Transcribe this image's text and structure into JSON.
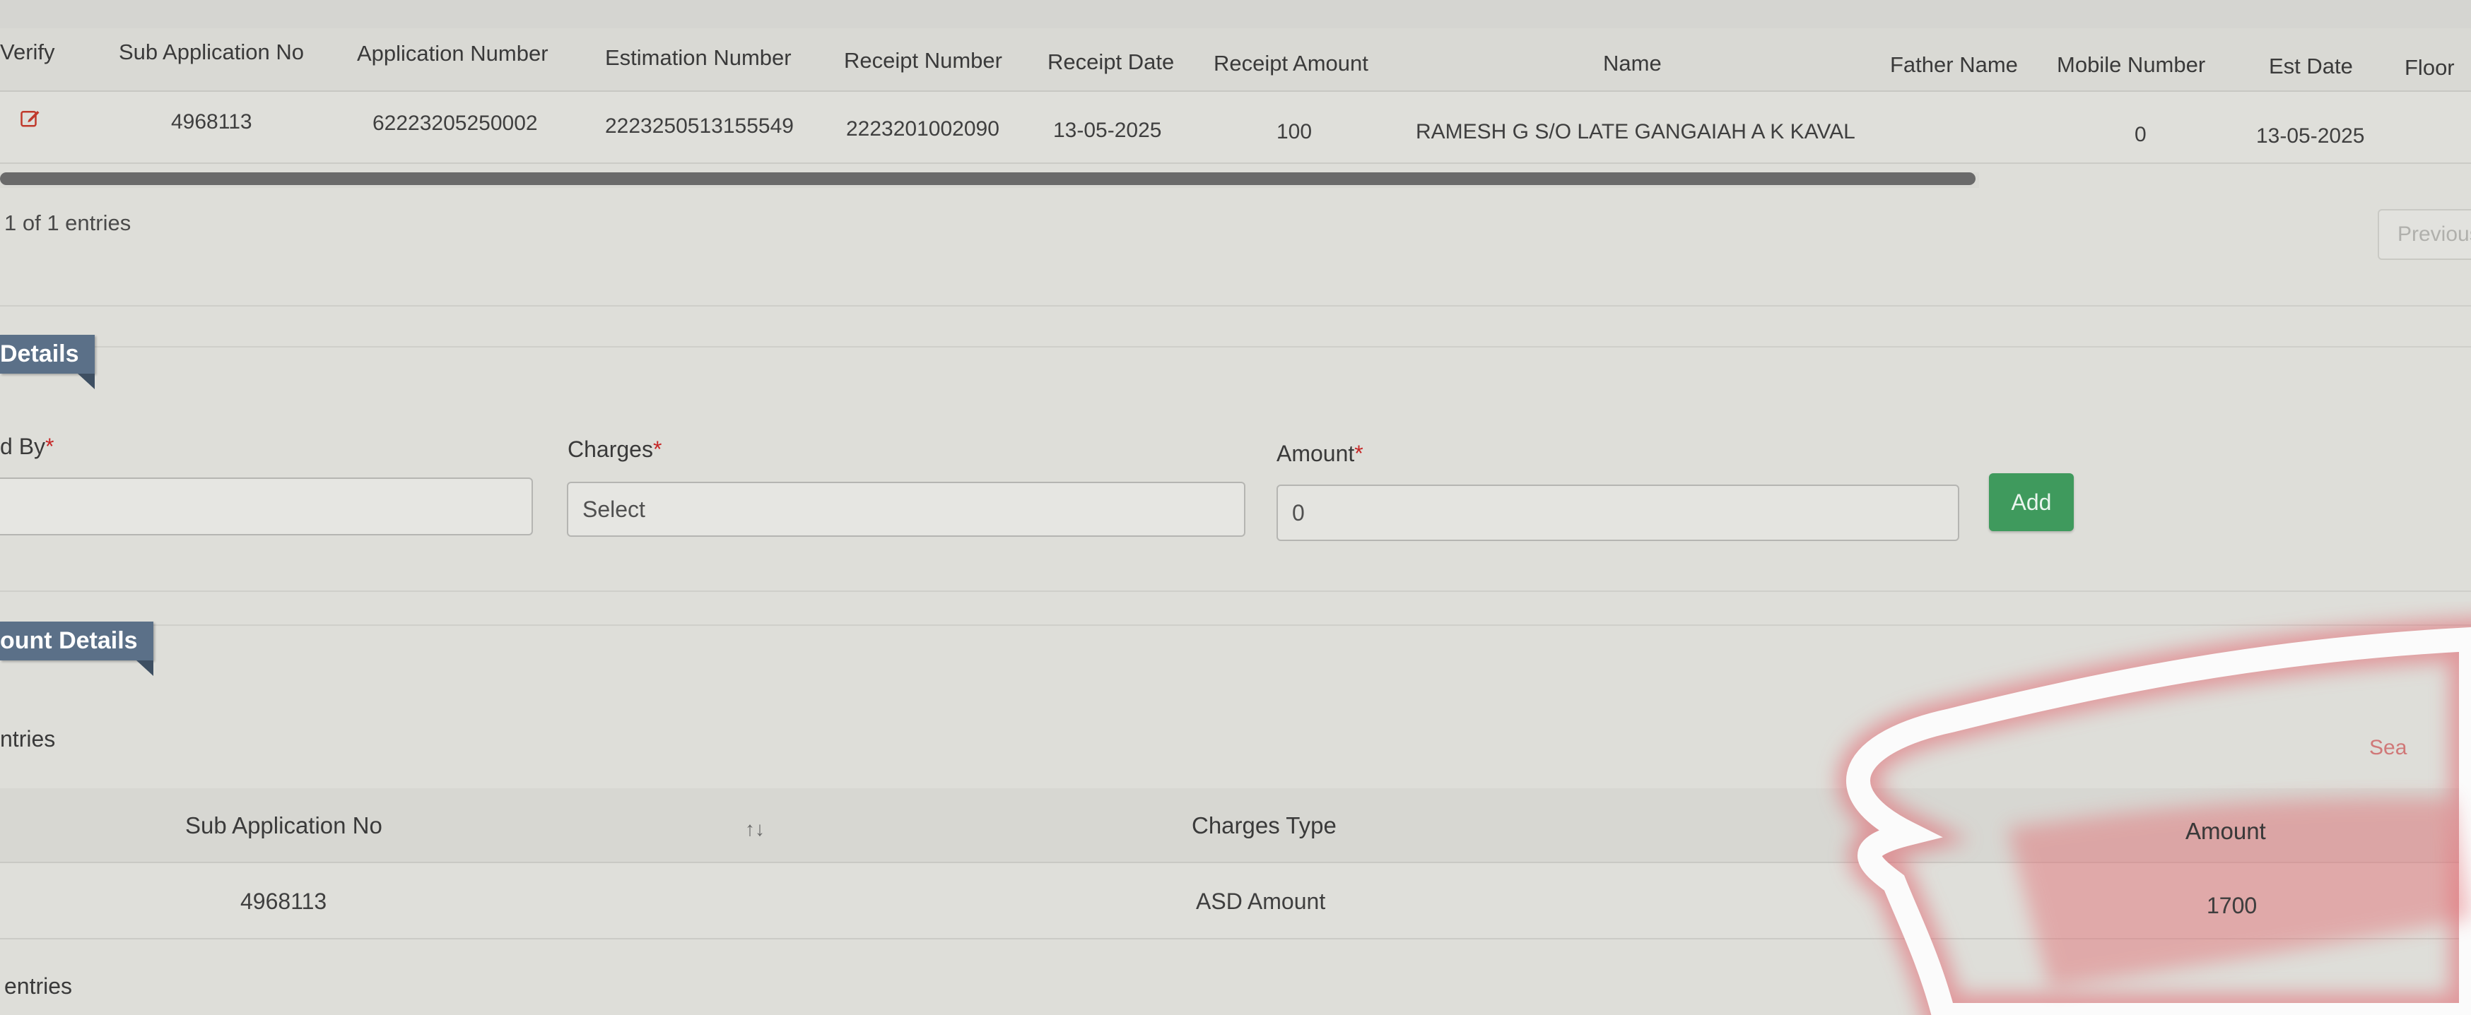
{
  "top_table": {
    "headers": [
      "Verify",
      "Sub Application No",
      "Application Number",
      "Estimation Number",
      "Receipt Number",
      "Receipt Date",
      "Receipt Amount",
      "Name",
      "Father Name",
      "Mobile Number",
      "Est Date",
      "Floor"
    ],
    "row": {
      "sub_application_no": "4968113",
      "application_number": "62223205250002",
      "estimation_number": "2223250513155549",
      "receipt_number": "2223201002090",
      "receipt_date": "13-05-2025",
      "receipt_amount": "100",
      "name": "RAMESH G S/O LATE GANGAIAH A K KAVAL",
      "mobile_number": "0",
      "est_date": "13-05-2025"
    },
    "info": "1 of 1 entries",
    "previous_label": "Previous"
  },
  "charges_section": {
    "title": "Details",
    "field1_label": "d By",
    "charges_label": "Charges",
    "charges_value": "Select",
    "amount_label": "Amount",
    "amount_value": "0",
    "add_label": "Add"
  },
  "amount_section": {
    "title": "ount Details",
    "entries_label": "ntries",
    "search_label": "Sea",
    "headers": [
      "Sub Application No",
      "Charges Type",
      "Amount"
    ],
    "sort_glyph": "↑↓",
    "row": {
      "sub_application_no": "4968113",
      "charges_type": "ASD Amount",
      "amount": "1700"
    },
    "footer": "entries"
  },
  "colors": {
    "accent_tag": "#5b7088",
    "add_button": "#3f9a5d",
    "required": "#c62828",
    "edit_icon": "#c0392b"
  }
}
